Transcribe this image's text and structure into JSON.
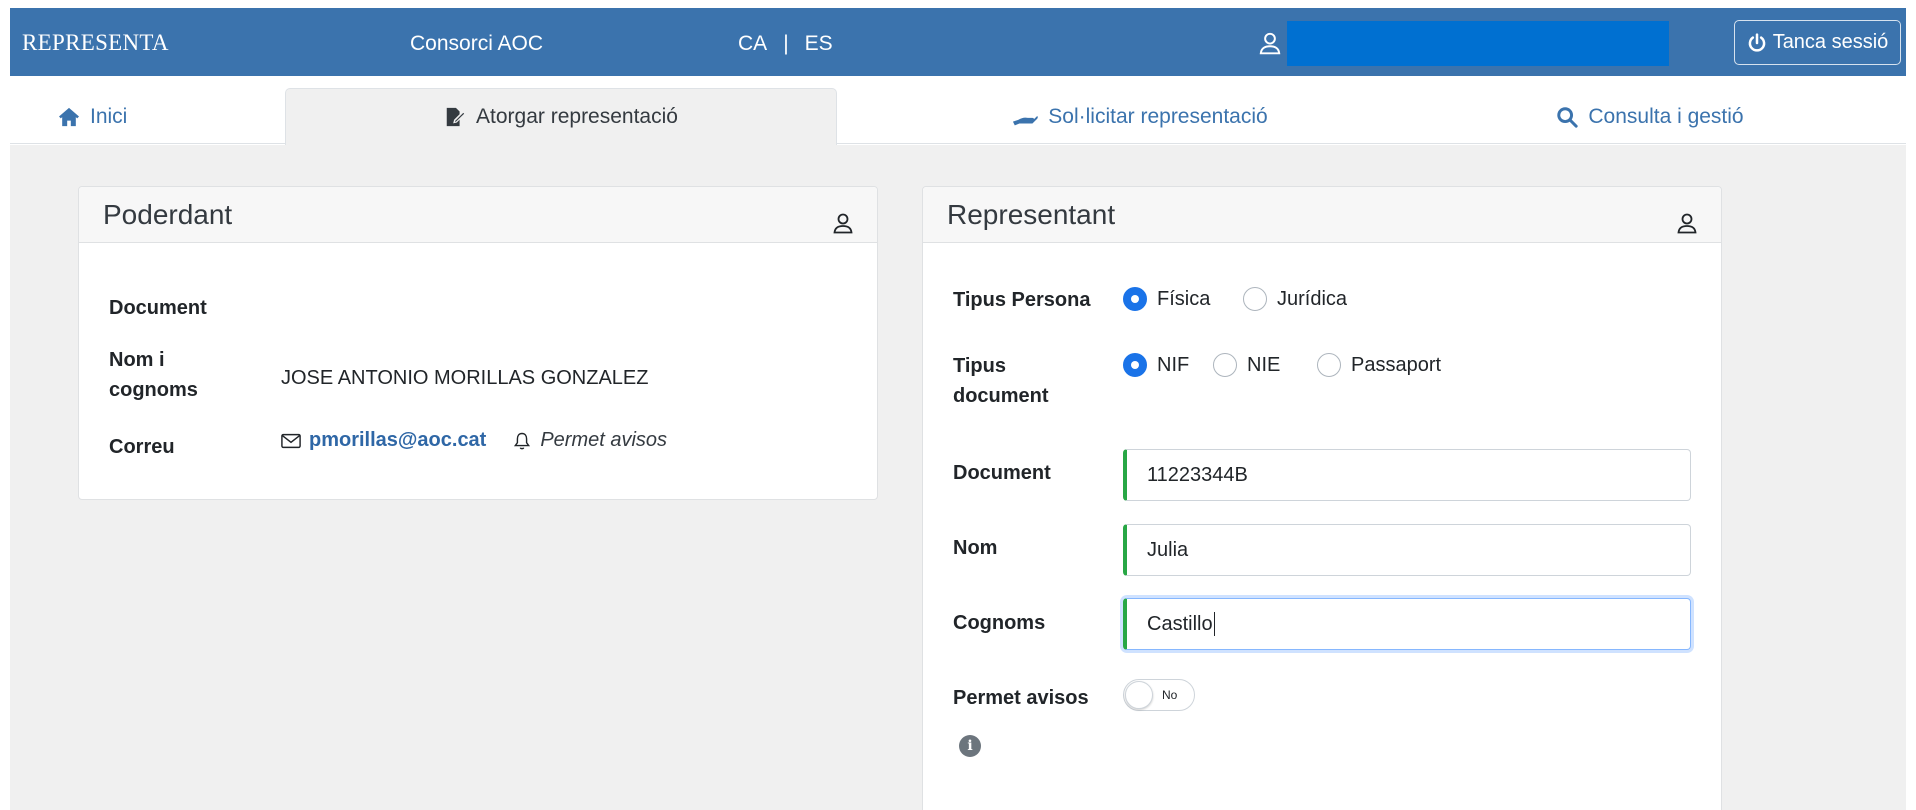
{
  "header": {
    "brand": "REPRESENTA",
    "organization": "Consorci AOC",
    "lang_ca": "CA",
    "lang_sep": "|",
    "lang_es": "ES",
    "logout_label": "Tanca sessió"
  },
  "tabs": [
    {
      "label": "Inici",
      "icon": "home-icon"
    },
    {
      "label": "Atorgar representació",
      "icon": "sign-document-icon"
    },
    {
      "label": "Sol·licitar representació",
      "icon": "hand-icon"
    },
    {
      "label": "Consulta i gestió",
      "icon": "search-icon"
    }
  ],
  "poderdant": {
    "title": "Poderdant",
    "document_label": "Document",
    "name_label_line1": "Nom i",
    "name_label_line2": "cognoms",
    "name_value": "JOSE ANTONIO MORILLAS GONZALEZ",
    "email_label": "Correu",
    "email_value": "pmorillas@aoc.cat",
    "avisos_label": "Permet avisos"
  },
  "representant": {
    "title": "Representant",
    "tipus_persona_label": "Tipus Persona",
    "tipus_persona_options": [
      "Física",
      "Jurídica"
    ],
    "tipus_persona_selected": "Física",
    "tipus_document_label_line1": "Tipus",
    "tipus_document_label_line2": "document",
    "tipus_document_options": [
      "NIF",
      "NIE",
      "Passaport"
    ],
    "tipus_document_selected": "NIF",
    "document_label": "Document",
    "document_value": "11223344B",
    "nom_label": "Nom",
    "nom_value": "Julia",
    "cognoms_label": "Cognoms",
    "cognoms_value": "Castillo",
    "permet_avisos_label": "Permet avisos",
    "permet_avisos_toggle": "No"
  },
  "colors": {
    "brand": "#3b73ad",
    "link": "#2f67a6",
    "valid": "#28a745",
    "radio_selected": "#1a73e8"
  }
}
